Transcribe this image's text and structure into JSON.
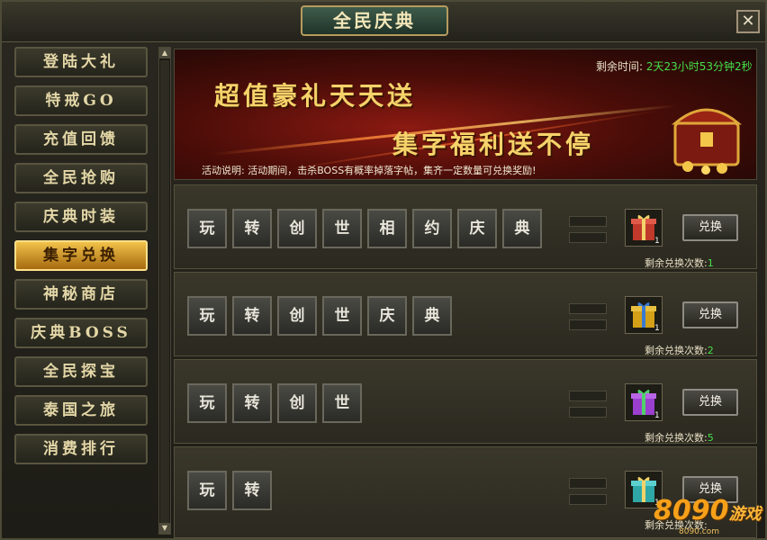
{
  "window": {
    "title": "全民庆典",
    "close_label": "✕"
  },
  "sidebar": {
    "items": [
      {
        "label": "登陆大礼",
        "active": false
      },
      {
        "label": "特戒GO",
        "active": false
      },
      {
        "label": "充值回馈",
        "active": false
      },
      {
        "label": "全民抢购",
        "active": false
      },
      {
        "label": "庆典时装",
        "active": false
      },
      {
        "label": "集字兑换",
        "active": true
      },
      {
        "label": "神秘商店",
        "active": false
      },
      {
        "label": "庆典BOSS",
        "active": false
      },
      {
        "label": "全民探宝",
        "active": false
      },
      {
        "label": "泰国之旅",
        "active": false
      },
      {
        "label": "消费排行",
        "active": false
      }
    ]
  },
  "banner": {
    "headline1": "超值豪礼天天送",
    "headline2": "集字福利送不停",
    "time_label": "剩余时间:",
    "time_value": "2天23小时53分钟2秒",
    "activity_note": "活动说明: 活动期间，击杀BOSS有概率掉落字帖，集齐一定数量可兑换奖励!"
  },
  "rows": [
    {
      "chars": [
        "玩",
        "转",
        "创",
        "世",
        "相",
        "约",
        "庆",
        "典"
      ],
      "gift_count": "1",
      "gift_color": "#c0392b",
      "redeem_label": "兑换",
      "remain_label": "剩余兑换次数:",
      "remain_count": "1"
    },
    {
      "chars": [
        "玩",
        "转",
        "创",
        "世",
        "庆",
        "典"
      ],
      "gift_count": "1",
      "gift_color": "#d4a017",
      "redeem_label": "兑换",
      "remain_label": "剩余兑换次数:",
      "remain_count": "2"
    },
    {
      "chars": [
        "玩",
        "转",
        "创",
        "世"
      ],
      "gift_count": "1",
      "gift_color": "#9b3fcf",
      "redeem_label": "兑换",
      "remain_label": "剩余兑换次数:",
      "remain_count": "5"
    },
    {
      "chars": [
        "玩",
        "转"
      ],
      "gift_count": "1",
      "gift_color": "#2fa7a7",
      "redeem_label": "兑换",
      "remain_label": "剩余兑换次数:",
      "remain_count": ""
    }
  ],
  "watermark": {
    "text": "8090",
    "text2": "游戏",
    "sub": "8090.com"
  },
  "colors": {
    "accent_gold": "#f6d36a",
    "remain_green": "#46e04a"
  }
}
